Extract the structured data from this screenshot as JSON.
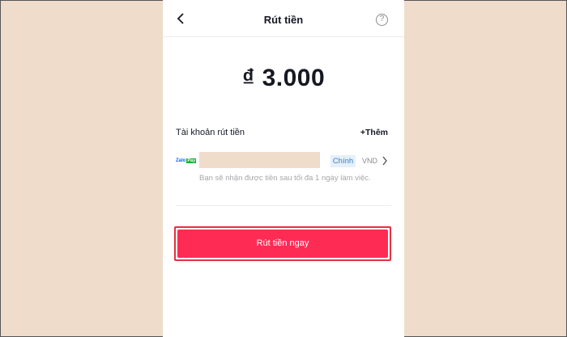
{
  "header": {
    "title": "Rút tiền",
    "back_icon": "chevron-left-icon",
    "help_icon": "help-circle-icon",
    "help_glyph": "?"
  },
  "amount": {
    "display": "₫ 3.000"
  },
  "account_section": {
    "label": "Tài khoản rút tiền",
    "add_link": "+Thêm"
  },
  "wallet": {
    "logo_text": "Zalo",
    "logo_suffix": "Pay",
    "badge": "Chính",
    "currency": "VND",
    "note": "Bạn sẽ nhận được tiền sau tối đa 1 ngày làm việc."
  },
  "cta": {
    "label": "Rút tiền ngay"
  },
  "colors": {
    "background": "#efdcca",
    "primary": "#fe2c55",
    "badge_bg": "#e4f0fa",
    "badge_text": "#3b7fc4"
  }
}
